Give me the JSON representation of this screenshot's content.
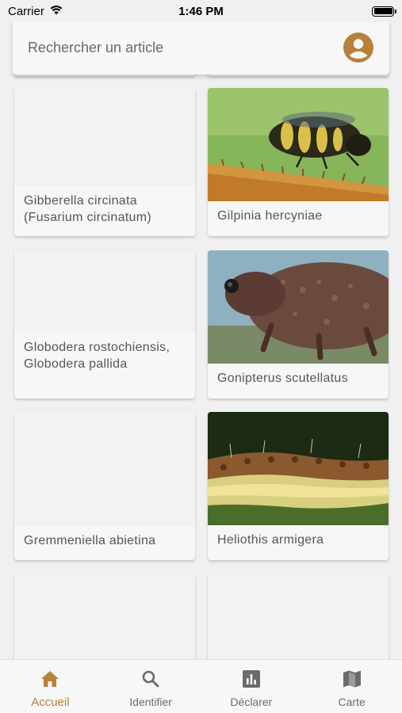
{
  "status": {
    "carrier": "Carrier",
    "time": "1:46 PM"
  },
  "search": {
    "placeholder": "Rechercher un article"
  },
  "colors": {
    "accent": "#b7813a",
    "icon_gray": "#6b6b6b"
  },
  "cards": [
    {
      "title": "Gibberella circinata (Fusarium circinatum)",
      "has_image": false
    },
    {
      "title": "Gilpinia hercyniae",
      "has_image": true,
      "image": "sawfly-on-pine-twig"
    },
    {
      "title": "Globodera rostochiensis, Globodera pallida",
      "has_image": false
    },
    {
      "title": "Gonipterus scutellatus",
      "has_image": true,
      "image": "weevil-close-up"
    },
    {
      "title": "Gremmeniella abietina",
      "has_image": false
    },
    {
      "title": "Heliothis armigera",
      "has_image": true,
      "image": "caterpillar-close-up"
    },
    {
      "title": "",
      "has_image": false
    },
    {
      "title": "",
      "has_image": false
    }
  ],
  "nav": {
    "items": [
      {
        "label": "Accueil",
        "icon": "home-icon",
        "active": true
      },
      {
        "label": "Identifier",
        "icon": "search-icon",
        "active": false
      },
      {
        "label": "Déclarer",
        "icon": "bar-chart-icon",
        "active": false
      },
      {
        "label": "Carte",
        "icon": "map-icon",
        "active": false
      }
    ]
  }
}
